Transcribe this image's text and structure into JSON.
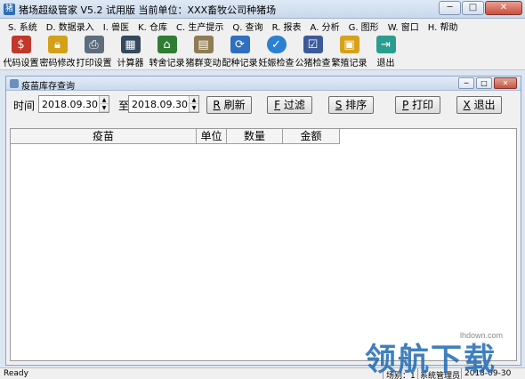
{
  "window": {
    "title": "猪场超级管家 V5.2 试用版  当前单位：XXX畜牧公司种猪场",
    "app_icon": "pig-app-icon",
    "buttons": {
      "minimize": "─",
      "maximize": "□",
      "close": "✕"
    }
  },
  "menu": [
    {
      "label": "S. 系统"
    },
    {
      "label": "D. 数据录入"
    },
    {
      "label": "I. 兽医"
    },
    {
      "label": "K. 仓库"
    },
    {
      "label": "C. 生产提示"
    },
    {
      "label": "Q. 查询"
    },
    {
      "label": "R. 报表"
    },
    {
      "label": "A. 分析"
    },
    {
      "label": "G. 图形"
    },
    {
      "label": "W. 窗口"
    },
    {
      "label": "H. 帮助"
    }
  ],
  "toolbar": [
    {
      "label": "代码设置",
      "icon": "code-settings-icon",
      "color": "#c0392b"
    },
    {
      "label": "密码修改",
      "icon": "lock-icon",
      "color": "#d4a017"
    },
    {
      "label": "打印设置",
      "icon": "printer-icon",
      "color": "#5d6d7e"
    },
    {
      "label": "计算器",
      "icon": "calculator-icon",
      "color": "#34495e"
    },
    {
      "label": "转舍记录",
      "icon": "barn-icon",
      "color": "#2e7d32"
    },
    {
      "label": "猪群变动",
      "icon": "document-icon",
      "color": "#8e7c52"
    },
    {
      "label": "配种记录",
      "icon": "refresh-icon",
      "color": "#2f6fc0"
    },
    {
      "label": "妊娠检查",
      "icon": "check-icon",
      "color": "#2c7fd1"
    },
    {
      "label": "公猪检查",
      "icon": "checklist-icon",
      "color": "#3c5a99"
    },
    {
      "label": "繁殖记录",
      "icon": "id-card-icon",
      "color": "#d6a21c"
    },
    {
      "label": "退出",
      "icon": "exit-door-icon",
      "color": "#2a9d8f"
    }
  ],
  "child_window": {
    "title": "疫苗库存查询",
    "buttons": {
      "minimize": "─",
      "maximize": "□",
      "close": "✕"
    },
    "time_label": "时间",
    "to_label": "至",
    "date_from": "2018.09.30",
    "date_to": "2018.09.30",
    "actions": [
      {
        "key": "R",
        "label": "刷新"
      },
      {
        "key": "F",
        "label": "过滤"
      },
      {
        "key": "S",
        "label": "排序"
      },
      {
        "key": "P",
        "label": "打印"
      },
      {
        "key": "X",
        "label": "退出"
      }
    ],
    "columns": [
      "疫苗",
      "单位",
      "数量",
      "金额"
    ]
  },
  "statusbar": {
    "ready": "Ready",
    "farm": "场别：1",
    "user": "系统管理员",
    "date": "2018-09-30"
  },
  "watermark": {
    "url": "lhdown.com",
    "text": "领航下载"
  }
}
